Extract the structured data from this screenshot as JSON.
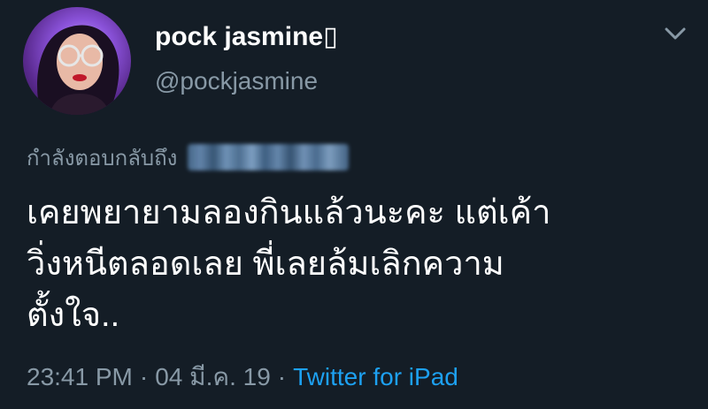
{
  "user": {
    "display_name": "pock jasmine",
    "name_glyph": "▯",
    "handle": "@pockjasmine"
  },
  "reply": {
    "label": "กำลังตอบกลับถึง"
  },
  "tweet": {
    "lines": [
      "เคยพยายามลองกินแล้วนะคะ แต่เค้า",
      "วิ่งหนีตลอดเลย พี่เลยล้มเลิกความ",
      "ตั้งใจ.."
    ]
  },
  "meta": {
    "time": "23:41 PM",
    "separator": "·",
    "date": "04 มี.ค. 19",
    "source": "Twitter for iPad"
  },
  "icons": {
    "menu": "chevron-down-icon"
  },
  "colors": {
    "background": "#141d26",
    "secondary_text": "#8899a6",
    "link": "#1da1f2"
  }
}
